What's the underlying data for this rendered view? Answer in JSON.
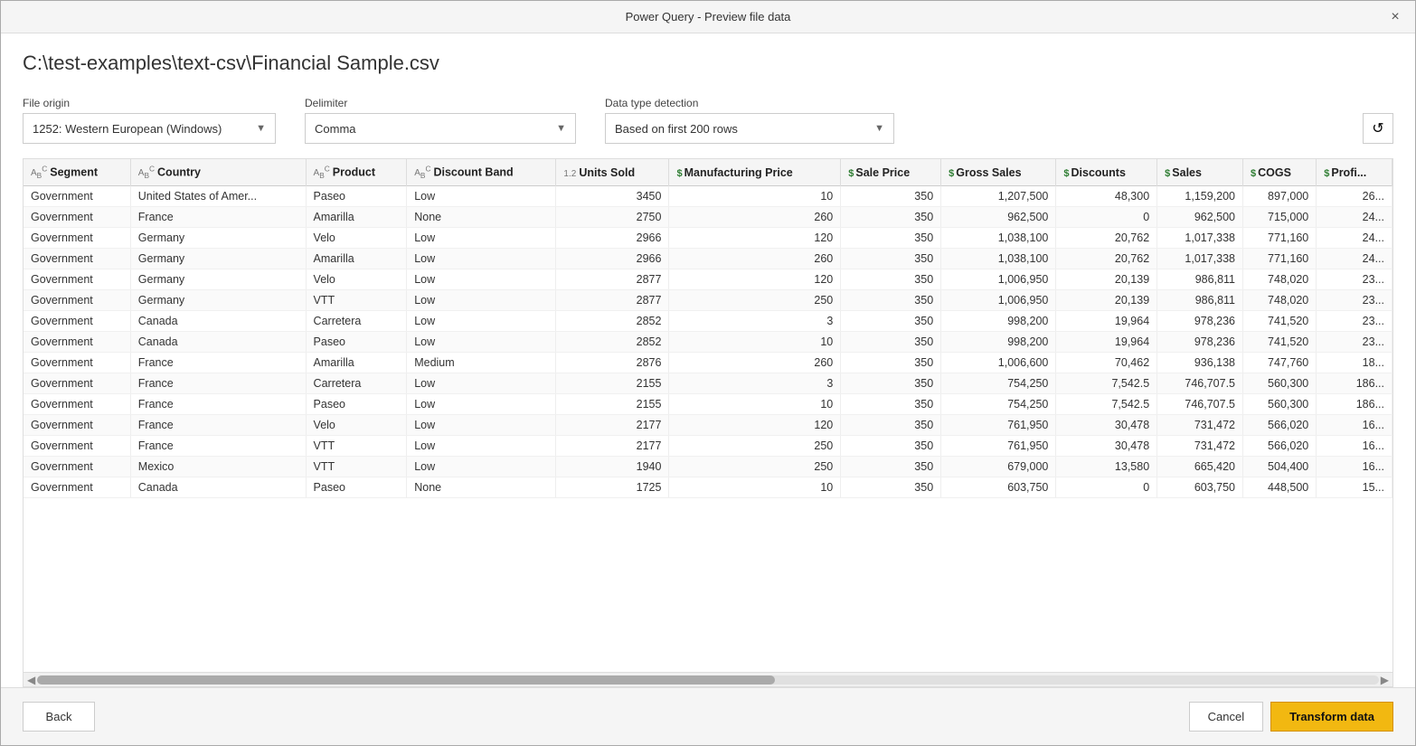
{
  "dialog": {
    "title": "Power Query - Preview file data",
    "close_label": "×"
  },
  "file_path": "C:\\test-examples\\text-csv\\Financial Sample.csv",
  "controls": {
    "file_origin_label": "File origin",
    "file_origin_value": "1252: Western European (Windows)",
    "delimiter_label": "Delimiter",
    "delimiter_value": "Comma",
    "data_type_label": "Data type detection",
    "data_type_value": "Based on first 200 rows"
  },
  "columns": [
    {
      "name": "Segment",
      "type": "ABC"
    },
    {
      "name": "Country",
      "type": "ABC"
    },
    {
      "name": "Product",
      "type": "ABC"
    },
    {
      "name": "Discount Band",
      "type": "ABC"
    },
    {
      "name": "Units Sold",
      "type": "1.2"
    },
    {
      "name": "Manufacturing Price",
      "type": "$"
    },
    {
      "name": "Sale Price",
      "type": "$"
    },
    {
      "name": "Gross Sales",
      "type": "$"
    },
    {
      "name": "Discounts",
      "type": "$"
    },
    {
      "name": "Sales",
      "type": "$"
    },
    {
      "name": "COGS",
      "type": "$"
    },
    {
      "name": "Profi...",
      "type": "$"
    }
  ],
  "rows": [
    [
      "Government",
      "United States of Amer...",
      "Paseo",
      "Low",
      "3450",
      "10",
      "350",
      "1,207,500",
      "48,300",
      "1,159,200",
      "897,000",
      "26..."
    ],
    [
      "Government",
      "France",
      "Amarilla",
      "None",
      "2750",
      "260",
      "350",
      "962,500",
      "0",
      "962,500",
      "715,000",
      "24..."
    ],
    [
      "Government",
      "Germany",
      "Velo",
      "Low",
      "2966",
      "120",
      "350",
      "1,038,100",
      "20,762",
      "1,017,338",
      "771,160",
      "24..."
    ],
    [
      "Government",
      "Germany",
      "Amarilla",
      "Low",
      "2966",
      "260",
      "350",
      "1,038,100",
      "20,762",
      "1,017,338",
      "771,160",
      "24..."
    ],
    [
      "Government",
      "Germany",
      "Velo",
      "Low",
      "2877",
      "120",
      "350",
      "1,006,950",
      "20,139",
      "986,811",
      "748,020",
      "23..."
    ],
    [
      "Government",
      "Germany",
      "VTT",
      "Low",
      "2877",
      "250",
      "350",
      "1,006,950",
      "20,139",
      "986,811",
      "748,020",
      "23..."
    ],
    [
      "Government",
      "Canada",
      "Carretera",
      "Low",
      "2852",
      "3",
      "350",
      "998,200",
      "19,964",
      "978,236",
      "741,520",
      "23..."
    ],
    [
      "Government",
      "Canada",
      "Paseo",
      "Low",
      "2852",
      "10",
      "350",
      "998,200",
      "19,964",
      "978,236",
      "741,520",
      "23..."
    ],
    [
      "Government",
      "France",
      "Amarilla",
      "Medium",
      "2876",
      "260",
      "350",
      "1,006,600",
      "70,462",
      "936,138",
      "747,760",
      "18..."
    ],
    [
      "Government",
      "France",
      "Carretera",
      "Low",
      "2155",
      "3",
      "350",
      "754,250",
      "7,542.5",
      "746,707.5",
      "560,300",
      "186..."
    ],
    [
      "Government",
      "France",
      "Paseo",
      "Low",
      "2155",
      "10",
      "350",
      "754,250",
      "7,542.5",
      "746,707.5",
      "560,300",
      "186..."
    ],
    [
      "Government",
      "France",
      "Velo",
      "Low",
      "2177",
      "120",
      "350",
      "761,950",
      "30,478",
      "731,472",
      "566,020",
      "16..."
    ],
    [
      "Government",
      "France",
      "VTT",
      "Low",
      "2177",
      "250",
      "350",
      "761,950",
      "30,478",
      "731,472",
      "566,020",
      "16..."
    ],
    [
      "Government",
      "Mexico",
      "VTT",
      "Low",
      "1940",
      "250",
      "350",
      "679,000",
      "13,580",
      "665,420",
      "504,400",
      "16..."
    ],
    [
      "Government",
      "Canada",
      "Paseo",
      "None",
      "1725",
      "10",
      "350",
      "603,750",
      "0",
      "603,750",
      "448,500",
      "15..."
    ]
  ],
  "footer": {
    "back_label": "Back",
    "cancel_label": "Cancel",
    "transform_label": "Transform data"
  }
}
